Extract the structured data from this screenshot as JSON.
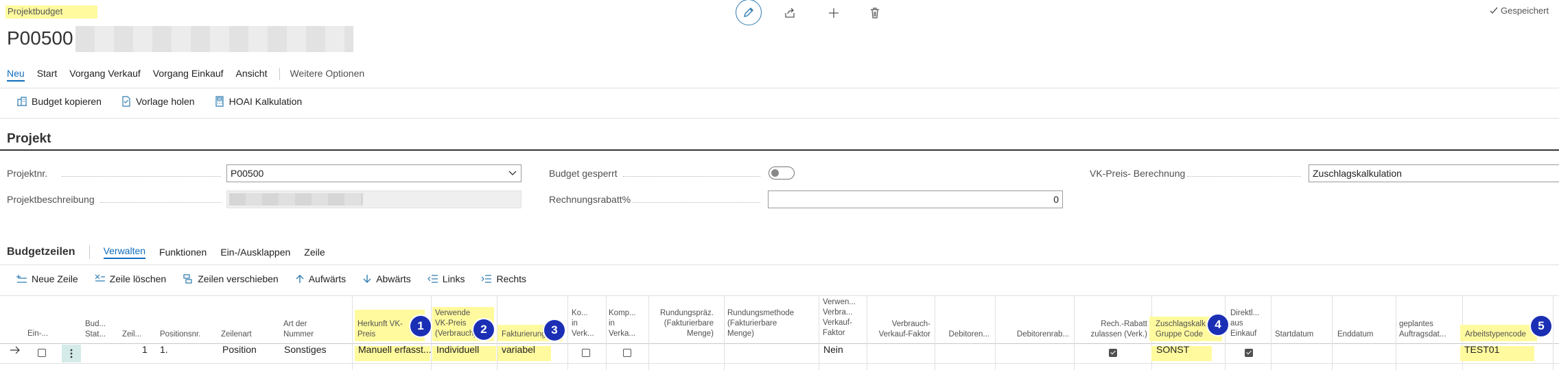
{
  "header": {
    "page_caption": "Projektbudget",
    "record_no": "P00500",
    "saved_label": "Gespeichert",
    "icons": [
      "edit-icon",
      "share-icon",
      "plus-icon",
      "delete-icon",
      "check-icon"
    ]
  },
  "menu": {
    "items": [
      "Neu",
      "Start",
      "Vorgang Verkauf",
      "Vorgang Einkauf",
      "Ansicht"
    ],
    "more": "Weitere Optionen"
  },
  "actions": [
    "Budget kopieren",
    "Vorlage holen",
    "HOAI Kalkulation"
  ],
  "projekt": {
    "title": "Projekt",
    "projektnr_label": "Projektnr.",
    "projektnr_value": "P00500",
    "beschreibung_label": "Projektbeschreibung",
    "budget_gesperrt_label": "Budget gesperrt",
    "budget_gesperrt_value": false,
    "rabatt_label": "Rechnungsrabatt%",
    "rabatt_value": "0",
    "vk_label": "VK-Preis- Berechnung",
    "vk_value": "Zuschlagskalkulation"
  },
  "budgetzeilen": {
    "title": "Budgetzeilen",
    "tabs": [
      "Verwalten",
      "Funktionen",
      "Ein-/Ausklappen",
      "Zeile"
    ],
    "line_actions": [
      "Neue Zeile",
      "Zeile löschen",
      "Zeilen verschieben",
      "Aufwärts",
      "Abwärts",
      "Links",
      "Rechts"
    ],
    "columns": {
      "ein": "Ein-...",
      "bud": "Bud...\nStat...",
      "zeil": "Zeil...",
      "positionsnr": "Positionsnr.",
      "zeilenart": "Zeilenart",
      "artder": "Art der\nNummer",
      "herkunft": "Herkunft VK-\nPreis",
      "verwende": "Verwende\nVK-Preis\n(Verbrauch)",
      "fakturierung": "Fakturierung",
      "ko": "Ko...\nin\nVerk...",
      "komp": "Komp...\nin\nVerka...",
      "rundungspraez": "Rundungspräz.\n(Fakturierbare\nMenge)",
      "rundungsmethode": "Rundungsmethode\n(Fakturierbare\nMenge)",
      "verwen_faktor": "Verwen...\nVerbra...\nVerkauf-\nFaktor",
      "verbrauch_faktor": "Verbrauch-\nVerkauf-Faktor",
      "debitoren1": "Debitoren...",
      "debitoren2": "Debitorenrab...",
      "rech_rabatt": "Rech.-Rabatt\nzulassen (Verk.)",
      "zuschlag": "Zuschlagskalk...\nGruppe Code",
      "direkt": "Direktl...\naus\nEinkauf",
      "startdatum": "Startdatum",
      "enddatum": "Enddatum",
      "geplantes": "geplantes\nAuftragsdat...",
      "arbeitstyp": "Arbeitstypencode"
    },
    "row": {
      "zeil": "1",
      "positionsnr": "1.",
      "zeilenart": "Position",
      "artder": "Sonstiges",
      "herkunft": "Manuell erfasst...",
      "verwende": "Individuell",
      "fakturierung": "variabel",
      "ko": false,
      "komp": false,
      "verwen_faktor": "Nein",
      "rech_rabatt": true,
      "zuschlag": "SONST",
      "direkt": true,
      "arbeitstyp": "TEST01"
    },
    "badges": [
      "1",
      "2",
      "3",
      "4",
      "5"
    ]
  },
  "colors": {
    "accent": "#0f6cbd",
    "highlight": "#fffa9e",
    "badge": "#1b2fb5"
  }
}
